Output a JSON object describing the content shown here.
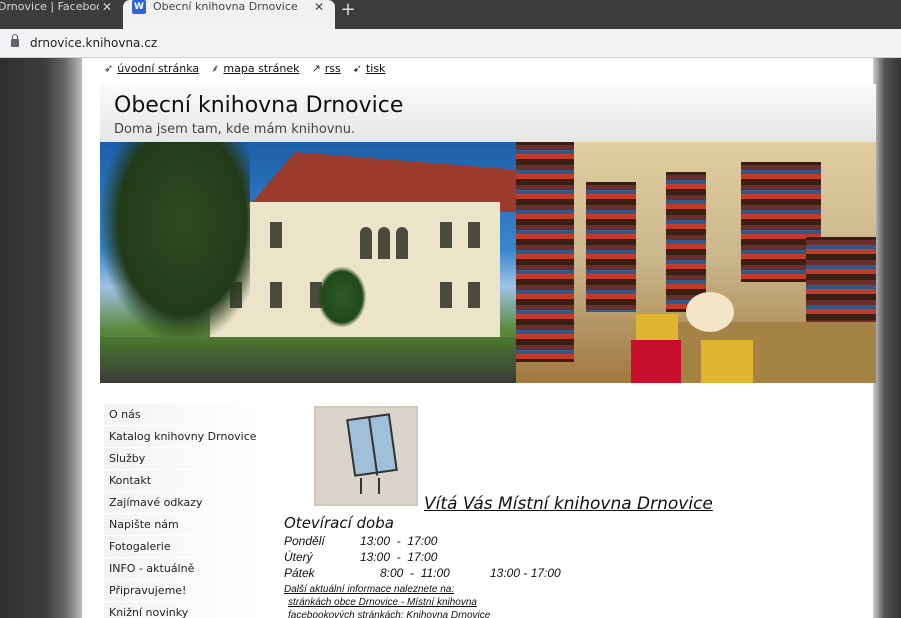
{
  "browser": {
    "tabs": [
      {
        "title": "Drnovice | Facebook",
        "active": false
      },
      {
        "title": "Obecní knihovna Drnovice",
        "active": true,
        "favicon": "W"
      }
    ],
    "close_glyph": "✕",
    "new_tab_glyph": "+",
    "url": "drnovice.knihovna.cz"
  },
  "toplinks": [
    {
      "icon": "home-icon",
      "label": "úvodní stránka"
    },
    {
      "icon": "sitemap-icon",
      "label": "mapa stránek"
    },
    {
      "icon": "rss-icon",
      "label": "rss"
    },
    {
      "icon": "print-icon",
      "label": "tisk"
    }
  ],
  "header": {
    "title": "Obecní knihovna Drnovice",
    "subtitle": "Doma jsem tam, kde mám knihovnu."
  },
  "menu": {
    "items": [
      "O nás",
      "Katalog knihovny Drnovice",
      "Služby",
      "Kontakt",
      "Zajímavé odkazy",
      "Napište nám",
      "Fotogalerie",
      "INFO - aktuálně",
      "Připravujeme!",
      "Knižní novinky"
    ]
  },
  "content": {
    "welcome": "Vítá Vás Místní knihovna Drnovice",
    "hours_title": "Otevírací doba",
    "hours": [
      {
        "day": "Pondělí",
        "time1": "13:00  -  17:00",
        "time2": ""
      },
      {
        "day": "Úterý",
        "time1": "13:00  -  17:00",
        "time2": ""
      },
      {
        "day": "Pátek",
        "time1": "8:00  -  11:00",
        "time2": "13:00 - 17:00"
      }
    ],
    "info_lines": [
      "Další aktuální informace naleznete na:",
      "stránkách obce Drnovice - Místní knihovna",
      "facebookových stránkách: Knihovna Drnovice"
    ]
  }
}
